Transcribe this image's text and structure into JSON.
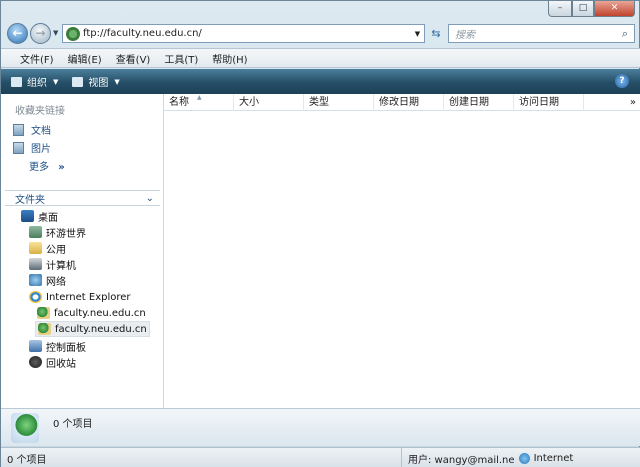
{
  "window": {
    "minimize": "–",
    "maximize": "□",
    "close": "✕"
  },
  "address": {
    "url": "ftp://faculty.neu.edu.cn/",
    "search_placeholder": "搜索"
  },
  "menubar": [
    {
      "label": "文件(F)"
    },
    {
      "label": "编辑(E)"
    },
    {
      "label": "查看(V)"
    },
    {
      "label": "工具(T)"
    },
    {
      "label": "帮助(H)"
    }
  ],
  "toolbar": {
    "organize": "组织",
    "view": "视图",
    "help": "?"
  },
  "sidebar": {
    "favorites_header": "收藏夹链接",
    "favorites": [
      {
        "label": "文档",
        "icon": "document-icon"
      },
      {
        "label": "图片",
        "icon": "picture-icon"
      }
    ],
    "more": "更多",
    "more_chevron": "»",
    "folders_header": "文件夹",
    "folders_chevron": "⌄",
    "tree": [
      {
        "label": "桌面",
        "icon": "desktop-icon",
        "level": 0
      },
      {
        "label": "环游世界",
        "icon": "folder-icon",
        "level": 1
      },
      {
        "label": "公用",
        "icon": "folder-icon",
        "level": 1
      },
      {
        "label": "计算机",
        "icon": "computer-icon",
        "level": 1
      },
      {
        "label": "网络",
        "icon": "network-icon",
        "level": 1
      },
      {
        "label": "Internet Explorer",
        "icon": "ie-icon",
        "level": 1
      },
      {
        "label": "faculty.neu.edu.cn",
        "icon": "ftp-icon",
        "level": 2
      },
      {
        "label": "faculty.neu.edu.cn",
        "icon": "ftp-icon",
        "level": 2,
        "selected": true
      },
      {
        "label": "控制面板",
        "icon": "control-panel-icon",
        "level": 1
      },
      {
        "label": "回收站",
        "icon": "recycle-bin-icon",
        "level": 1
      }
    ]
  },
  "columns": [
    {
      "label": "名称"
    },
    {
      "label": "大小"
    },
    {
      "label": "类型"
    },
    {
      "label": "修改日期"
    },
    {
      "label": "创建日期"
    },
    {
      "label": "访问日期"
    }
  ],
  "columns_more": "»",
  "details_pane": {
    "count": "0 个项目"
  },
  "status": {
    "left": "0 个项目",
    "user": "用户: wangy@mail.ne",
    "zone": "Internet"
  },
  "colors": {
    "toolbar": "#254e66",
    "link": "#1e4e85"
  }
}
